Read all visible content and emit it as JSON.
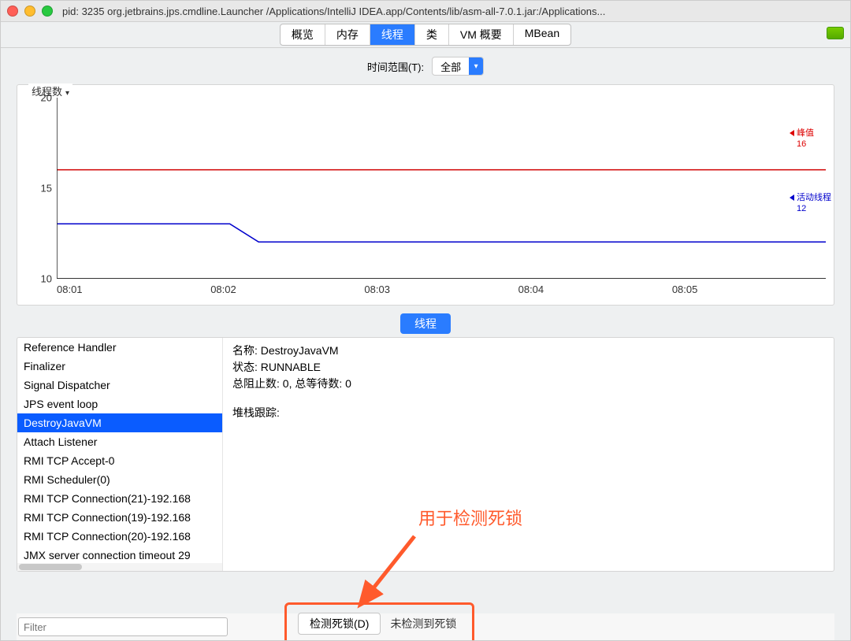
{
  "window": {
    "title": "pid: 3235 org.jetbrains.jps.cmdline.Launcher /Applications/IntelliJ IDEA.app/Contents/lib/asm-all-7.0.1.jar:/Applications..."
  },
  "tabs": {
    "overview": "概览",
    "memory": "内存",
    "threads": "线程",
    "classes": "类",
    "vm_summary": "VM 概要",
    "mbean": "MBean",
    "active": "threads"
  },
  "time_range": {
    "label": "时间范围(T):",
    "value": "全部"
  },
  "chart": {
    "title": "线程数",
    "legend_peak_label": "峰值",
    "legend_peak_value": "16",
    "legend_live_label": "活动线程",
    "legend_live_value": "12"
  },
  "chart_data": {
    "type": "line",
    "xlabel": "",
    "ylabel": "",
    "ylim": [
      10,
      20
    ],
    "x_ticks": [
      "08:01",
      "08:02",
      "08:03",
      "08:04",
      "08:05"
    ],
    "y_ticks": [
      10,
      15,
      20
    ],
    "series": [
      {
        "name": "峰值",
        "color": "#d00000",
        "x": [
          0,
          1,
          2,
          3,
          4
        ],
        "y": [
          16,
          16,
          16,
          16,
          16
        ]
      },
      {
        "name": "活动线程",
        "color": "#0000cc",
        "x": [
          0,
          0.9,
          1.05,
          4
        ],
        "y": [
          13,
          13,
          12,
          12
        ]
      }
    ]
  },
  "section_tab": "线程",
  "thread_list": {
    "items": [
      "Reference Handler",
      "Finalizer",
      "Signal Dispatcher",
      "JPS event loop",
      "DestroyJavaVM",
      "Attach Listener",
      "RMI TCP Accept-0",
      "RMI Scheduler(0)",
      "RMI TCP Connection(21)-192.168",
      "RMI TCP Connection(19)-192.168",
      "RMI TCP Connection(20)-192.168",
      "JMX server connection timeout 29"
    ],
    "selected_index": 4
  },
  "thread_detail": {
    "name_label": "名称",
    "name_value": "DestroyJavaVM",
    "state_label": "状态",
    "state_value": "RUNNABLE",
    "blocked_label": "总阻止数",
    "blocked_value": "0",
    "waited_label": "总等待数",
    "waited_value": "0",
    "stack_label": "堆栈跟踪:"
  },
  "filter": {
    "placeholder": "Filter"
  },
  "deadlock": {
    "button": "检测死锁(D)",
    "status": "未检测到死锁"
  },
  "annotation": {
    "label": "用于检测死锁"
  }
}
